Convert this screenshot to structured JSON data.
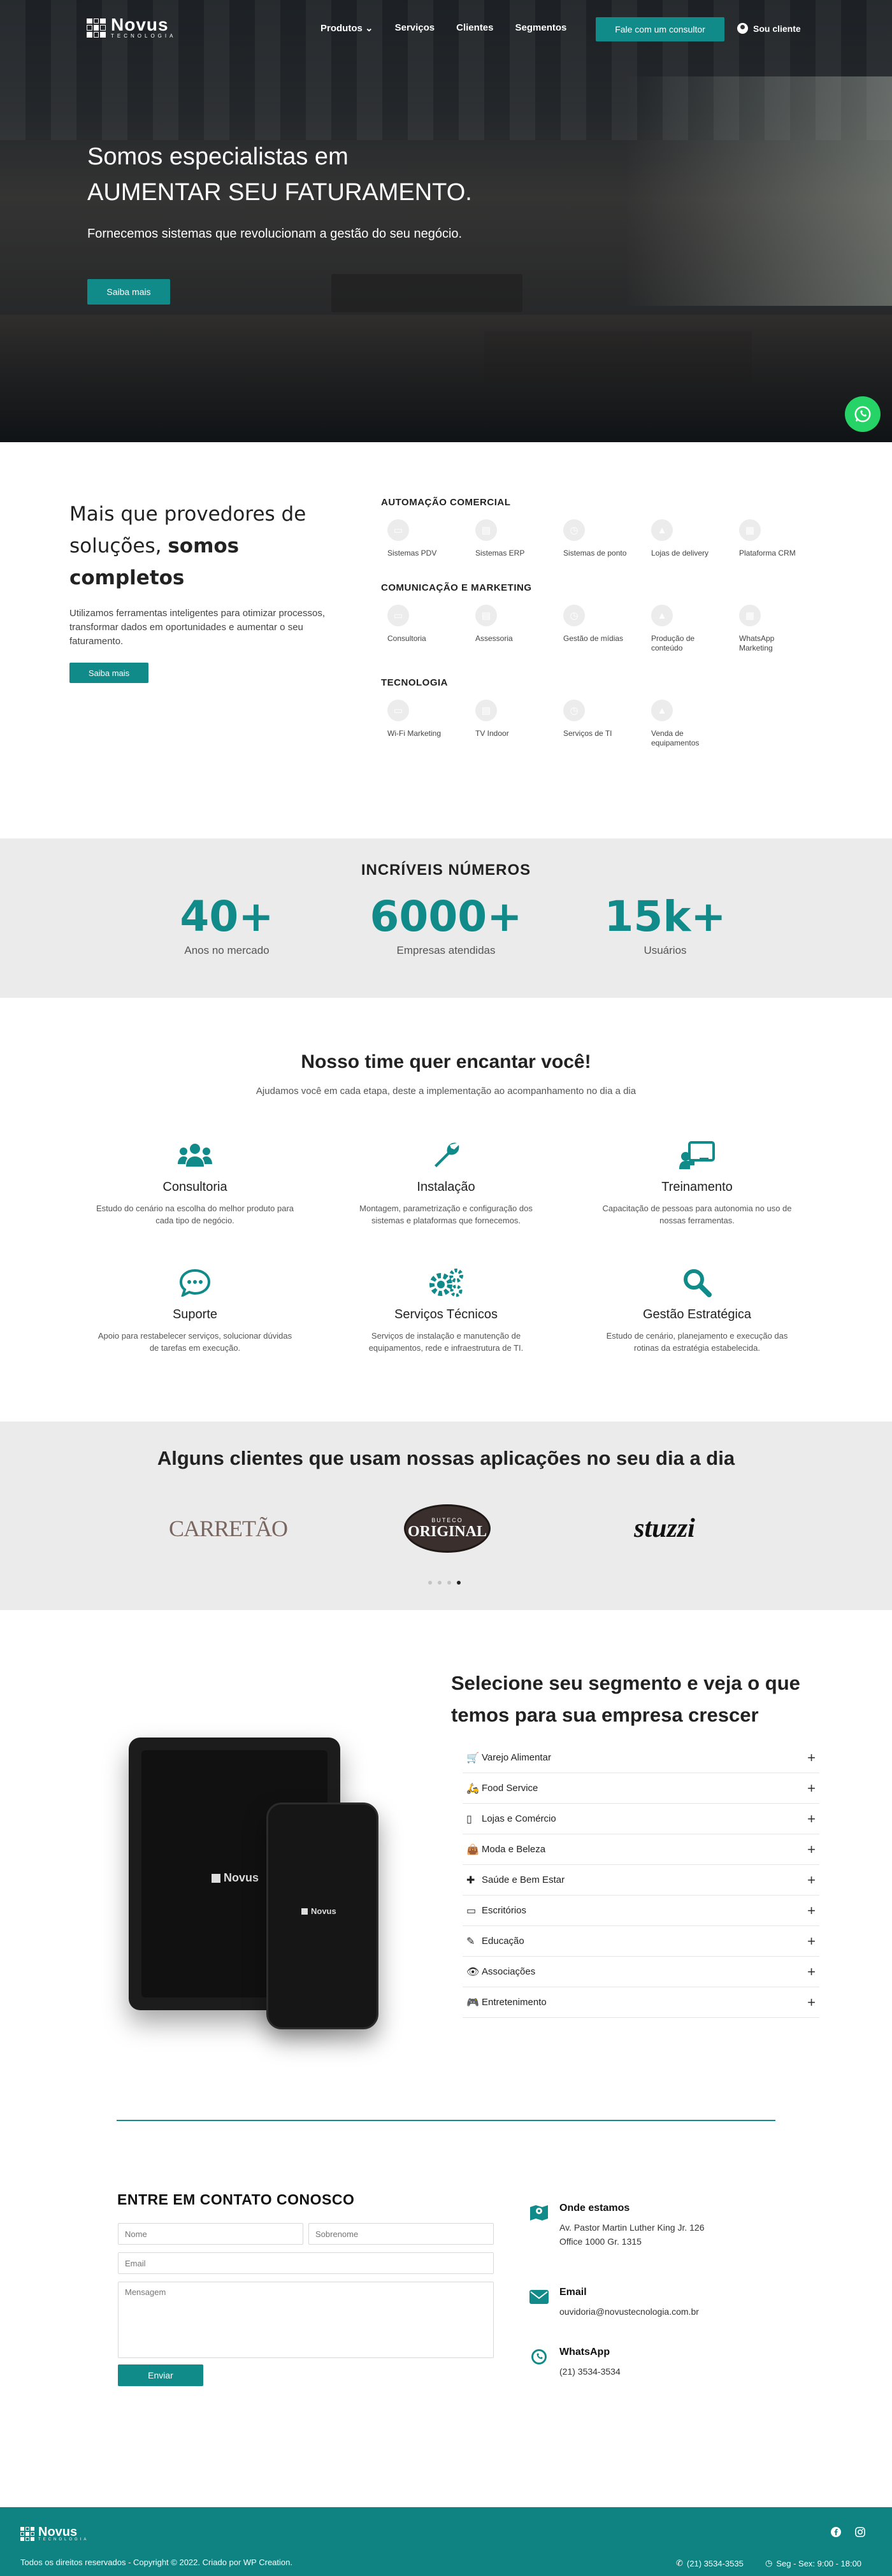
{
  "header": {
    "logo_name": "Novus",
    "logo_sub": "TECNOLOGIA",
    "menu": [
      "Produtos",
      "Serviços",
      "Clientes",
      "Segmentos"
    ],
    "cta": "Fale com um consultor",
    "client_link": "Sou cliente"
  },
  "hero": {
    "title_line1": "Somos especialistas em",
    "title_line2": "AUMENTAR SEU FATURAMENTO.",
    "subtitle": "Fornecemos sistemas que revolucionam a gestão do seu negócio.",
    "button": "Saiba mais"
  },
  "solutions": {
    "title_part1": "Mais que provedores de soluções, ",
    "title_bold": "somos completos",
    "description": "Utilizamos ferramentas inteligentes para otimizar processos, transformar dados em oportunidades e aumentar o seu faturamento.",
    "button": "Saiba mais",
    "categories": [
      {
        "title": "AUTOMAÇÃO COMERCIAL",
        "items": [
          "Sistemas PDV",
          "Sistemas ERP",
          "Sistemas de ponto",
          "Lojas de delivery",
          "Plataforma CRM"
        ]
      },
      {
        "title": "COMUNICAÇÃO E MARKETING",
        "items": [
          "Consultoria",
          "Assessoria",
          "Gestão de mídias",
          "Produção de conteúdo",
          "WhatsApp Marketing"
        ]
      },
      {
        "title": "TECNOLOGIA",
        "items": [
          "Wi-Fi Marketing",
          "TV Indoor",
          "Serviços de TI",
          "Venda de equipamentos"
        ]
      }
    ]
  },
  "numbers": {
    "title": "INCRÍVEIS NÚMEROS",
    "items": [
      {
        "value": "40+",
        "label": "Anos no mercado"
      },
      {
        "value": "6000+",
        "label": "Empresas atendidas"
      },
      {
        "value": "15k+",
        "label": "Usuários"
      }
    ]
  },
  "team": {
    "title_part1": "Nosso time quer ",
    "title_bold": "encantar",
    "title_part2": " você!",
    "subtitle": "Ajudamos você em cada etapa, deste a implementação ao acompanhamento no dia a dia",
    "services": [
      {
        "name": "Consultoria",
        "desc": "Estudo do cenário na escolha do melhor produto para cada tipo de negócio."
      },
      {
        "name": "Instalação",
        "desc": "Montagem, parametrização e configuração dos sistemas e plataformas que fornecemos."
      },
      {
        "name": "Treinamento",
        "desc": "Capacitação de pessoas para autonomia no uso de nossas ferramentas."
      },
      {
        "name": "Suporte",
        "desc": "Apoio para restabelecer serviços, solucionar dúvidas de tarefas em execução."
      },
      {
        "name": "Serviços Técnicos",
        "desc": "Serviços de instalação e manutenção de equipamentos, rede e infraestrutura de TI."
      },
      {
        "name": "Gestão Estratégica",
        "desc": "Estudo de cenário, planejamento e execução das rotinas da estratégia estabelecida."
      }
    ]
  },
  "clients": {
    "title_part1": "Alguns ",
    "title_bold": "clientes que usam nossas aplicações",
    "title_part2": " no seu dia a dia",
    "logos": [
      "CARRETÃO",
      "BUTECO",
      "ORIGINAL",
      "stuzzi"
    ]
  },
  "segments": {
    "title_bold": "Selecione seu segmento",
    "title_rest": " e veja o que temos para sua empresa crescer",
    "items": [
      "Varejo Alimentar",
      "Food Service",
      "Lojas e Comércio",
      "Moda e Beleza",
      "Saúde e Bem Estar",
      "Escritórios",
      "Educação",
      "Associações",
      "Entretenimento"
    ],
    "plus": "+"
  },
  "contact": {
    "title": "ENTRE EM CONTATO CONOSCO",
    "placeholders": {
      "name": "Nome",
      "surname": "Sobrenome",
      "email": "Email",
      "message": "Mensagem"
    },
    "button": "Enviar",
    "location_head": "Onde estamos",
    "address_line1": "Av. Pastor Martin Luther King Jr. 126",
    "address_line2": "Office 1000 Gr. 1315",
    "email_head": "Email",
    "email": "ouvidoria@novustecnologia.com.br",
    "whatsapp_head": "WhatsApp",
    "whatsapp": "(21) 3534-3534"
  },
  "footer": {
    "copy": "Todos os direitos reservados - Copyright © 2022. Criado por WP Creation.",
    "phone": "(21) 3534-3535",
    "hours": "Seg - Sex: 9:00 - 18:00"
  },
  "colors": {
    "accent": "#118a8a",
    "light_bg": "#ebebeb",
    "whatsapp": "#25d366"
  }
}
